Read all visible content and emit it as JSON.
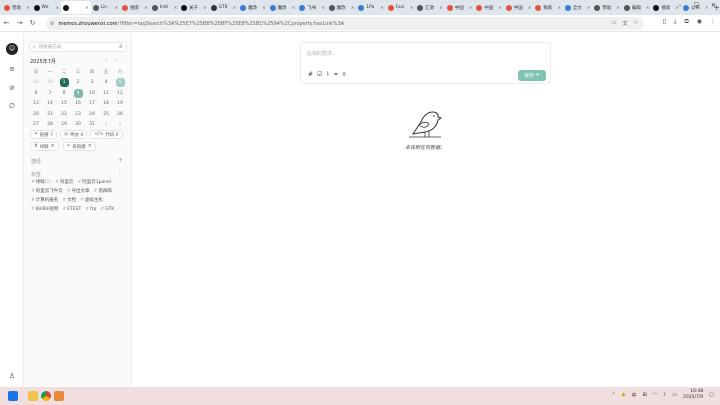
{
  "browser": {
    "tabs": [
      {
        "label": "赞助",
        "color": "#e5533d"
      },
      {
        "label": "We",
        "color": "#111111"
      },
      {
        "label": "",
        "color": "#111111",
        "active": true
      },
      {
        "label": "Lin",
        "color": "#555555"
      },
      {
        "label": "搜索",
        "color": "#e5533d"
      },
      {
        "label": "Indi",
        "color": "#555555"
      },
      {
        "label": "关于",
        "color": "#111111"
      },
      {
        "label": "GTK",
        "color": "#333333"
      },
      {
        "label": "魔改",
        "color": "#3a7bd5"
      },
      {
        "label": "魔改",
        "color": "#3a7bd5"
      },
      {
        "label": "飞书",
        "color": "#3a7bd5"
      },
      {
        "label": "魔改",
        "color": "#555555"
      },
      {
        "label": "1Pa",
        "color": "#3a7bd5"
      },
      {
        "label": "Favi",
        "color": "#e5533d"
      },
      {
        "label": "汇款",
        "color": "#555555"
      },
      {
        "label": "中国",
        "color": "#e5533d"
      },
      {
        "label": "中国",
        "color": "#e5533d"
      },
      {
        "label": "中国",
        "color": "#e5533d"
      },
      {
        "label": "探索",
        "color": "#e5533d"
      },
      {
        "label": "全文",
        "color": "#3a7bd5"
      },
      {
        "label": "赞助",
        "color": "#555555"
      },
      {
        "label": "编辑",
        "color": "#555555"
      },
      {
        "label": "搜索",
        "color": "#111111"
      },
      {
        "label": "公布",
        "color": "#3a7bd5"
      }
    ],
    "new_tab": "+",
    "url_domain": "memos.zhouwenxi.com",
    "url_rest": "/?filter=tagSearch%3A%25E7%25BB%25BF%25E8%25B1%2594%2Cproperty.hasLink%3A"
  },
  "calendar": {
    "title": "2025年7月",
    "weekdays": [
      "日",
      "一",
      "二",
      "三",
      "四",
      "五",
      "六"
    ],
    "days": [
      {
        "d": "29",
        "m": true
      },
      {
        "d": "30",
        "m": true
      },
      {
        "d": "1",
        "s": "today"
      },
      {
        "d": "2"
      },
      {
        "d": "3"
      },
      {
        "d": "4"
      },
      {
        "d": "5",
        "s": "mark2"
      },
      {
        "d": "6"
      },
      {
        "d": "7"
      },
      {
        "d": "8"
      },
      {
        "d": "9",
        "s": "mark1"
      },
      {
        "d": "10"
      },
      {
        "d": "11"
      },
      {
        "d": "12"
      },
      {
        "d": "13"
      },
      {
        "d": "14"
      },
      {
        "d": "15"
      },
      {
        "d": "16"
      },
      {
        "d": "17"
      },
      {
        "d": "18"
      },
      {
        "d": "19"
      },
      {
        "d": "20"
      },
      {
        "d": "21"
      },
      {
        "d": "22"
      },
      {
        "d": "23"
      },
      {
        "d": "24"
      },
      {
        "d": "25"
      },
      {
        "d": "26"
      },
      {
        "d": "27"
      },
      {
        "d": "28"
      },
      {
        "d": "29"
      },
      {
        "d": "30"
      },
      {
        "d": "31"
      },
      {
        "d": "1",
        "m": true
      },
      {
        "d": "2",
        "m": true
      }
    ]
  },
  "sidebar": {
    "search_placeholder": "搜索备忘录",
    "stats": {
      "links": "链接 7",
      "todo": "待办 0",
      "code": "代码 0"
    },
    "filters": [
      {
        "label": "绿联"
      },
      {
        "label": "有链接"
      }
    ],
    "shortcuts_label": "捷径",
    "tags_label": "标签",
    "tags": [
      {
        "name": "绿联",
        "count": "(2)"
      },
      {
        "name": "阿里云",
        "count": ""
      },
      {
        "name": "阿里云1panel",
        "count": ""
      },
      {
        "name": "阿里云飞牛云",
        "count": ""
      },
      {
        "name": "导出文章",
        "count": ""
      },
      {
        "name": "黑群晖",
        "count": ""
      },
      {
        "name": "计算机报名",
        "count": ""
      },
      {
        "name": "文档",
        "count": ""
      },
      {
        "name": "虚拟主机",
        "count": ""
      },
      {
        "name": "BiliBili视频",
        "count": ""
      },
      {
        "name": "ETEST",
        "count": ""
      },
      {
        "name": "frp",
        "count": ""
      },
      {
        "name": "GTK",
        "count": ""
      }
    ]
  },
  "editor": {
    "placeholder": "此刻的想法...",
    "save_label": "保存"
  },
  "empty_state": {
    "message": "未找到任何数据。"
  },
  "taskbar": {
    "ime": "中",
    "time": "16:48",
    "date": "2025/7/9"
  }
}
